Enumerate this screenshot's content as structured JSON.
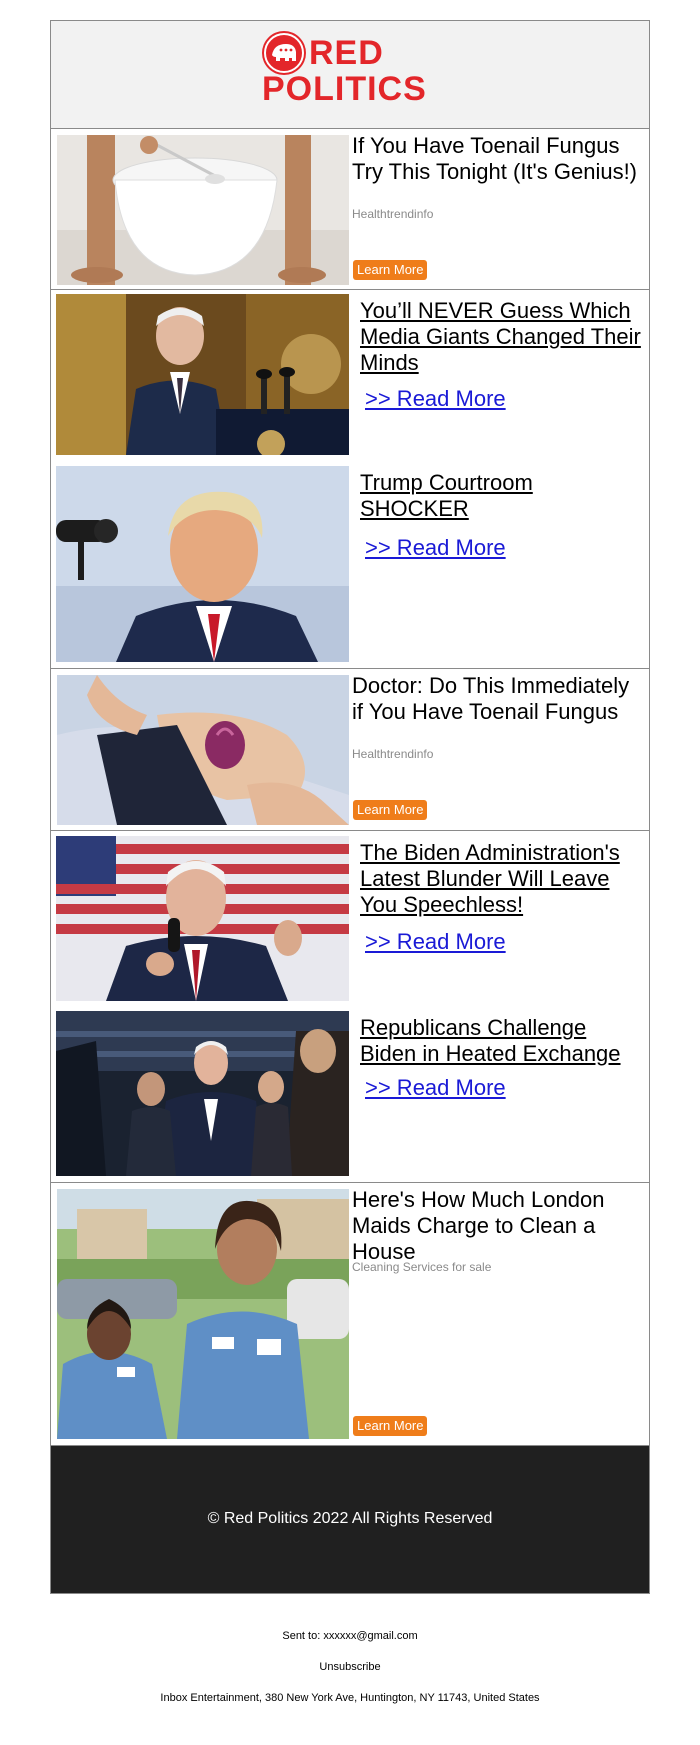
{
  "brand": {
    "logo_line1": "RED",
    "logo_line2": "POLITICS",
    "color": "#e3262a"
  },
  "ads": [
    {
      "title": "If You Have Toenail Fungus Try This Tonight (It's Genius!)",
      "source": "Healthtrendinfo",
      "cta": "Learn More"
    },
    {
      "title": "Doctor: Do This Immediately if You Have Toenail Fungus",
      "source": "Healthtrendinfo",
      "cta": "Learn More"
    },
    {
      "title": "Here's How Much London Maids Charge to Clean a House",
      "source": "Cleaning Services for sale",
      "cta": "Learn More"
    }
  ],
  "stories": [
    {
      "headline": "You’ll NEVER Guess Which Media Giants Changed Their Minds",
      "read_more": ">> Read More"
    },
    {
      "headline": "Trump Courtroom SHOCKER",
      "read_more": ">> Read More"
    },
    {
      "headline": "The Biden Administration's Latest Blunder Will Leave You Speechless!",
      "read_more": ">> Read More"
    },
    {
      "headline": "Republicans Challenge Biden in Heated Exchange",
      "read_more": ">> Read More"
    }
  ],
  "footer": {
    "copyright": "© Red Politics 2022 All Rights Reserved"
  },
  "meta": {
    "sent_to": "Sent to: xxxxxx@gmail.com",
    "unsubscribe": "Unsubscribe",
    "address": "Inbox Entertainment, 380 New York Ave, Huntington, NY 11743, United States"
  },
  "colors": {
    "cta": "#ef7d1a",
    "link": "#1a1ad6",
    "footer_bg": "#202020"
  }
}
